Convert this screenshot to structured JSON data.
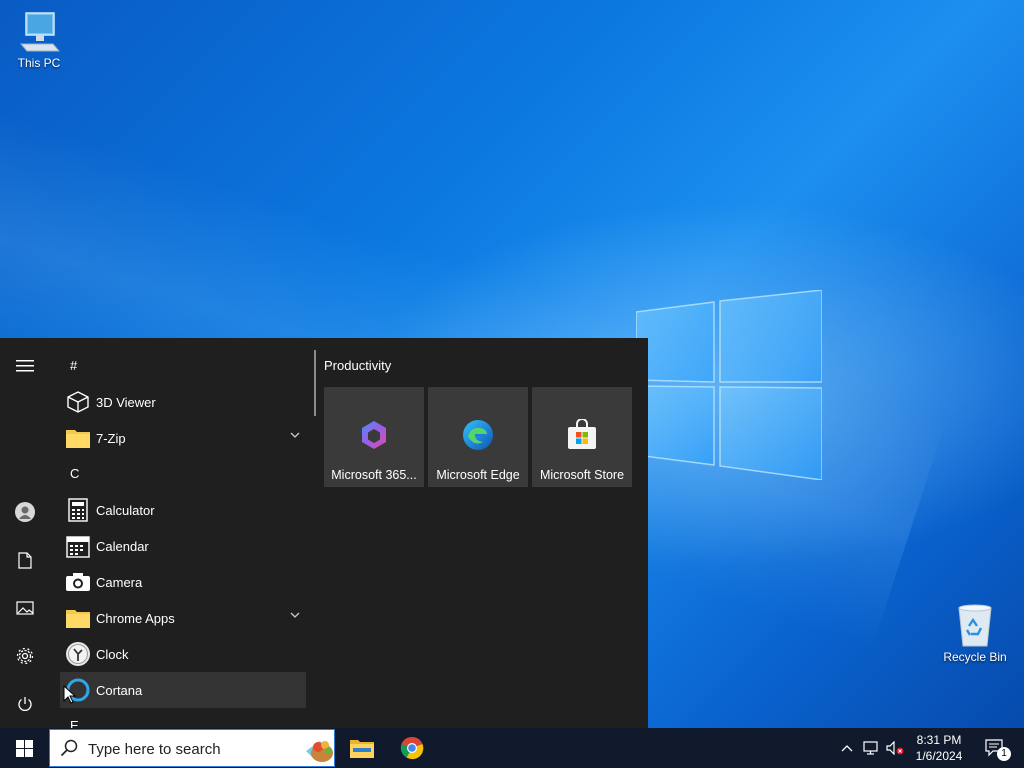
{
  "desktop": {
    "icons": [
      {
        "label": "This PC",
        "icon": "this-pc-icon"
      },
      {
        "label": "Recycle Bin",
        "icon": "recycle-bin-icon"
      }
    ]
  },
  "start_menu": {
    "rail": [
      "hamburger-icon",
      "user-account-icon",
      "documents-icon",
      "pictures-icon",
      "settings-icon",
      "power-icon"
    ],
    "app_list": [
      {
        "type": "letter",
        "label": "#"
      },
      {
        "type": "app",
        "label": "3D Viewer",
        "icon": "3d-viewer-icon"
      },
      {
        "type": "folder",
        "label": "7-Zip",
        "icon": "folder-icon"
      },
      {
        "type": "letter",
        "label": "C"
      },
      {
        "type": "app",
        "label": "Calculator",
        "icon": "calculator-icon"
      },
      {
        "type": "app",
        "label": "Calendar",
        "icon": "calendar-icon"
      },
      {
        "type": "app",
        "label": "Camera",
        "icon": "camera-icon"
      },
      {
        "type": "folder",
        "label": "Chrome Apps",
        "icon": "folder-icon"
      },
      {
        "type": "app",
        "label": "Clock",
        "icon": "clock-icon"
      },
      {
        "type": "app",
        "label": "Cortana",
        "icon": "cortana-icon"
      },
      {
        "type": "letter",
        "label": "E"
      }
    ],
    "group_title": "Productivity",
    "tiles": [
      {
        "label": "Microsoft 365...",
        "icon": "microsoft-365-icon"
      },
      {
        "label": "Microsoft Edge",
        "icon": "edge-icon"
      },
      {
        "label": "Microsoft Store",
        "icon": "store-icon"
      }
    ]
  },
  "taskbar": {
    "search_placeholder": "Type here to search",
    "pinned": [
      "file-explorer-icon",
      "chrome-icon"
    ],
    "time": "8:31 PM",
    "date": "1/6/2024",
    "notification_count": "1"
  },
  "colors": {
    "accent": "#0078d7",
    "start_menu_bg": "#1f1f1f",
    "tile_bg": "#3a3a3a",
    "taskbar_bg": "#101a2c"
  }
}
